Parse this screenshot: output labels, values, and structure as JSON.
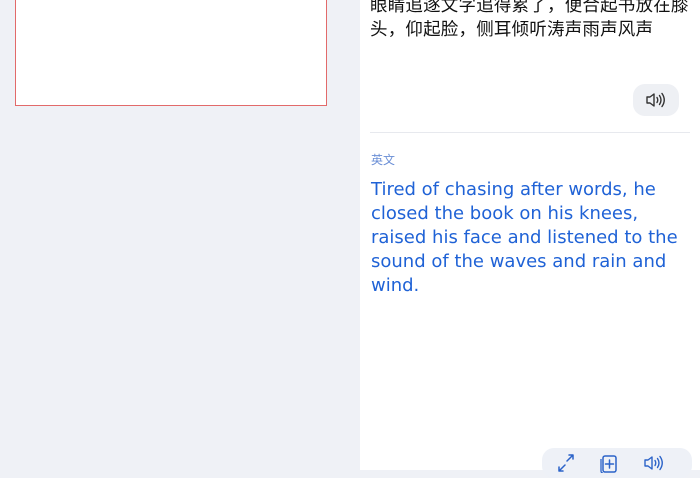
{
  "source": {
    "text": "眼睛追逐文字追得累了，便合起书放在膝头，仰起脸，侧耳倾听涛声雨声风声",
    "speaker_icon": "speaker-icon"
  },
  "target": {
    "language_label": "英文",
    "text": "Tired of chasing after words, he closed the book on his knees, raised his face and listened to the sound of the waves and rain and wind."
  },
  "toolbar": {
    "items": [
      "expand-icon",
      "add-to-notebook-icon",
      "speaker-icon"
    ]
  },
  "colors": {
    "accent_blue": "#1f62d6",
    "frame_red": "#e26a6a",
    "background": "#eff1f6"
  }
}
